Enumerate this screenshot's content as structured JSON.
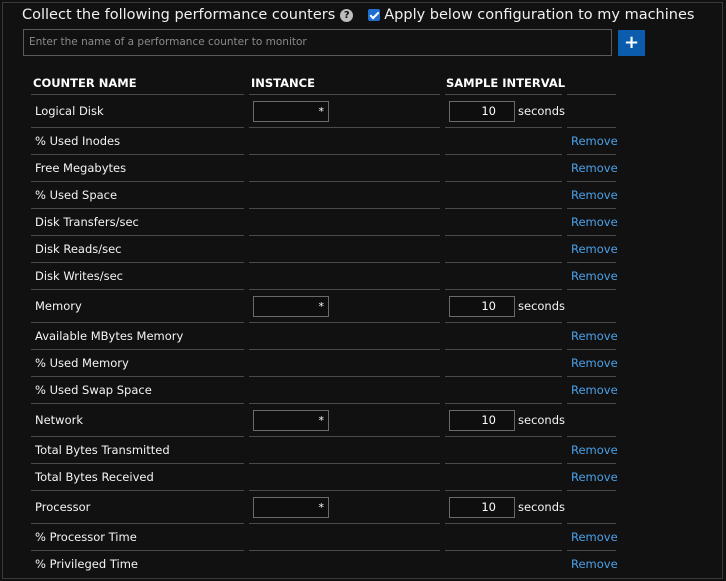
{
  "header": {
    "title": "Collect the following performance counters",
    "help_icon": "help-circle-icon",
    "apply_label": "Apply below configuration to my machines",
    "apply_checked": true
  },
  "search": {
    "placeholder": "Enter the name of a performance counter to monitor"
  },
  "add_button": {
    "label": "+"
  },
  "columns": {
    "name": "COUNTER NAME",
    "instance": "INSTANCE",
    "interval": "SAMPLE INTERVAL"
  },
  "rows": [
    {
      "kind": "group",
      "name": "Logical Disk",
      "instance": "*",
      "interval": "10",
      "unit": "seconds"
    },
    {
      "kind": "counter",
      "name": "% Used Inodes",
      "action": "Remove"
    },
    {
      "kind": "counter",
      "name": "Free Megabytes",
      "action": "Remove"
    },
    {
      "kind": "counter",
      "name": "% Used Space",
      "action": "Remove"
    },
    {
      "kind": "counter",
      "name": "Disk Transfers/sec",
      "action": "Remove"
    },
    {
      "kind": "counter",
      "name": "Disk Reads/sec",
      "action": "Remove"
    },
    {
      "kind": "counter",
      "name": "Disk Writes/sec",
      "action": "Remove"
    },
    {
      "kind": "group",
      "name": "Memory",
      "instance": "*",
      "interval": "10",
      "unit": "seconds"
    },
    {
      "kind": "counter",
      "name": "Available MBytes Memory",
      "action": "Remove"
    },
    {
      "kind": "counter",
      "name": "% Used Memory",
      "action": "Remove"
    },
    {
      "kind": "counter",
      "name": "% Used Swap Space",
      "action": "Remove"
    },
    {
      "kind": "group",
      "name": "Network",
      "instance": "*",
      "interval": "10",
      "unit": "seconds"
    },
    {
      "kind": "counter",
      "name": "Total Bytes Transmitted",
      "action": "Remove"
    },
    {
      "kind": "counter",
      "name": "Total Bytes Received",
      "action": "Remove"
    },
    {
      "kind": "group",
      "name": "Processor",
      "instance": "*",
      "interval": "10",
      "unit": "seconds"
    },
    {
      "kind": "counter",
      "name": "% Processor Time",
      "action": "Remove"
    },
    {
      "kind": "counter",
      "name": "% Privileged Time",
      "action": "Remove"
    }
  ]
}
